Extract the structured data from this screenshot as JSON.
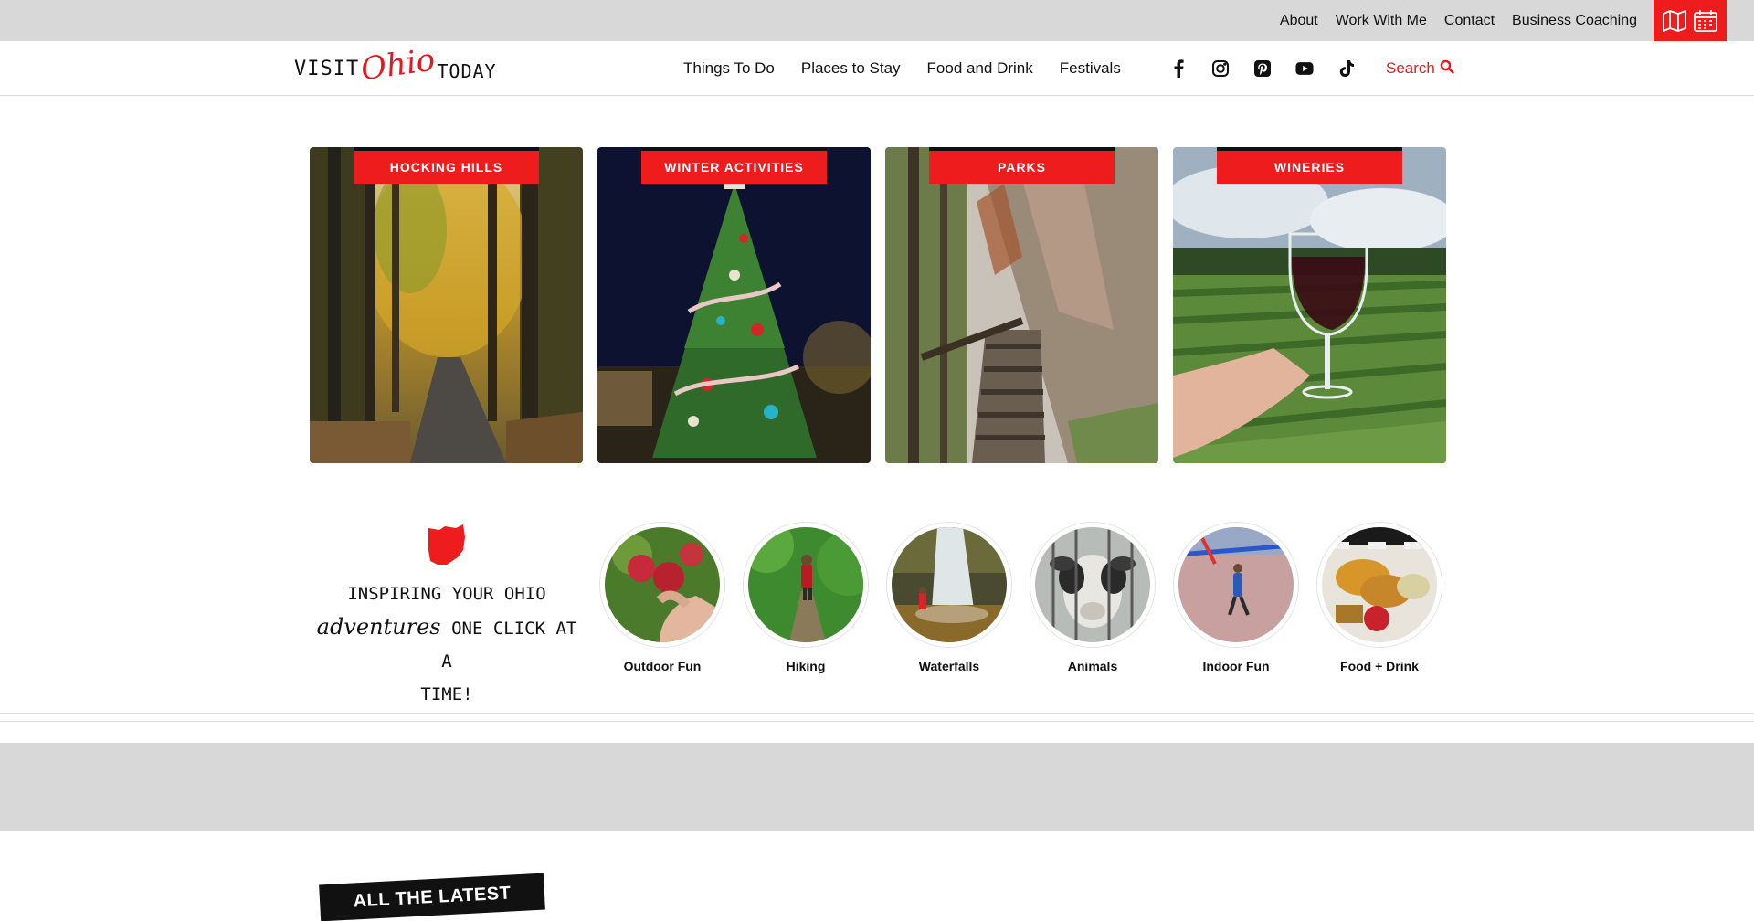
{
  "utility": {
    "links": [
      "About",
      "Work With Me",
      "Contact",
      "Business Coaching"
    ],
    "tools": [
      {
        "icon": "map-icon"
      },
      {
        "icon": "calendar-icon"
      }
    ],
    "tool_color": "#ee1c1c"
  },
  "logo": {
    "part1": "VISIT",
    "part2": "Ohio",
    "part3": "TODAY"
  },
  "nav": [
    "Things To Do",
    "Places to Stay",
    "Food and Drink",
    "Festivals"
  ],
  "social": [
    "facebook-icon",
    "instagram-icon",
    "pinterest-icon",
    "youtube-icon",
    "tiktok-icon"
  ],
  "search": {
    "label": "Search",
    "icon": "search-icon"
  },
  "cards": [
    {
      "label": "HOCKING HILLS",
      "photo": "autumn forest trail"
    },
    {
      "label": "WINTER ACTIVITIES",
      "photo": "decorated christmas tree at night"
    },
    {
      "label": "PARKS",
      "photo": "stone stairs beside cliff"
    },
    {
      "label": "WINERIES",
      "photo": "wine glass over vineyard"
    }
  ],
  "tagline": {
    "line1": "INSPIRING YOUR OHIO",
    "script": "adventures",
    "line2": "ONE CLICK AT A",
    "line3": "TIME!"
  },
  "circles": [
    {
      "label": "Outdoor Fun"
    },
    {
      "label": "Hiking"
    },
    {
      "label": "Waterfalls"
    },
    {
      "label": "Animals"
    },
    {
      "label": "Indoor Fun"
    },
    {
      "label": "Food + Drink"
    }
  ],
  "latest": {
    "label": "ALL THE LATEST"
  },
  "colors": {
    "accent": "#ee1c1c",
    "band": "#d8d8d8",
    "text": "#111111"
  }
}
